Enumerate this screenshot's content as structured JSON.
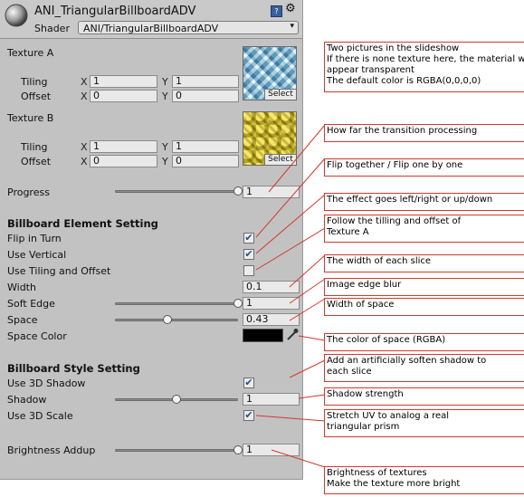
{
  "header": {
    "title": "ANI_TriangularBillboardADV",
    "shader_label": "Shader",
    "shader_value": "ANI/TriangularBillboardADV",
    "help_icon": "book-help-icon",
    "settings_icon": "gear-icon"
  },
  "texture_a": {
    "label": "Texture A",
    "tiling_label": "Tiling",
    "offset_label": "Offset",
    "x_label": "X",
    "y_label": "Y",
    "tiling_x": "1",
    "tiling_y": "1",
    "offset_x": "0",
    "offset_y": "0",
    "select_label": "Select"
  },
  "texture_b": {
    "label": "Texture B",
    "tiling_label": "Tiling",
    "offset_label": "Offset",
    "x_label": "X",
    "y_label": "Y",
    "tiling_x": "1",
    "tiling_y": "1",
    "offset_x": "0",
    "offset_y": "0",
    "select_label": "Select"
  },
  "progress": {
    "label": "Progress",
    "value": "1",
    "slider_fraction": 1.0
  },
  "billboard_element": {
    "heading": "Billboard Element Setting",
    "flip_in_turn": {
      "label": "Flip in Turn",
      "checked": true
    },
    "use_vertical": {
      "label": "Use Vertical",
      "checked": true
    },
    "use_tiling_offset": {
      "label": "Use Tiling and Offset",
      "checked": false
    },
    "width": {
      "label": "Width",
      "value": "0.1"
    },
    "soft_edge": {
      "label": "Soft Edge",
      "value": "1",
      "slider_fraction": 1.0
    },
    "space": {
      "label": "Space",
      "value": "0.43",
      "slider_fraction": 0.43
    },
    "space_color": {
      "label": "Space Color",
      "color": "#000000",
      "picker_icon": "eyedropper-icon"
    }
  },
  "billboard_style": {
    "heading": "Billboard Style Setting",
    "use_3d_shadow": {
      "label": "Use 3D Shadow",
      "checked": true
    },
    "shadow": {
      "label": "Shadow",
      "value": "1",
      "slider_fraction": 0.5
    },
    "use_3d_scale": {
      "label": "Use 3D Scale",
      "checked": true
    }
  },
  "brightness": {
    "label": "Brightness Addup",
    "value": "1",
    "slider_fraction": 1.0
  },
  "annotations": {
    "texture_a": [
      "Two pictures in the slideshow",
      "If there is none texture here, the material will",
      "appear transparent",
      "The default color is RGBA(0,0,0,0)"
    ],
    "progress": [
      "How far the transition processing"
    ],
    "flip": [
      "Flip together / Flip one by one"
    ],
    "vertical": [
      "The effect goes left/right or up/down"
    ],
    "tiling": [
      "Follow the tilling and offset of",
      "Texture A"
    ],
    "width": [
      "The width of each slice"
    ],
    "soft_edge": [
      "Image edge blur"
    ],
    "space": [
      "Width of space"
    ],
    "space_color": [
      "The color of space (RGBA)"
    ],
    "shadow3d": [
      "Add an artificially soften shadow to",
      "each slice"
    ],
    "shadow_strength": [
      "Shadow strength"
    ],
    "scale3d": [
      "Stretch UV to analog a real",
      "triangular prism"
    ],
    "brightness": [
      "Brightness of textures",
      "Make the texture more bright"
    ]
  },
  "colors": {
    "panel": "#c2c2c2",
    "annotation_line": "#d2392e",
    "checkmark": "#1d4f8a"
  }
}
